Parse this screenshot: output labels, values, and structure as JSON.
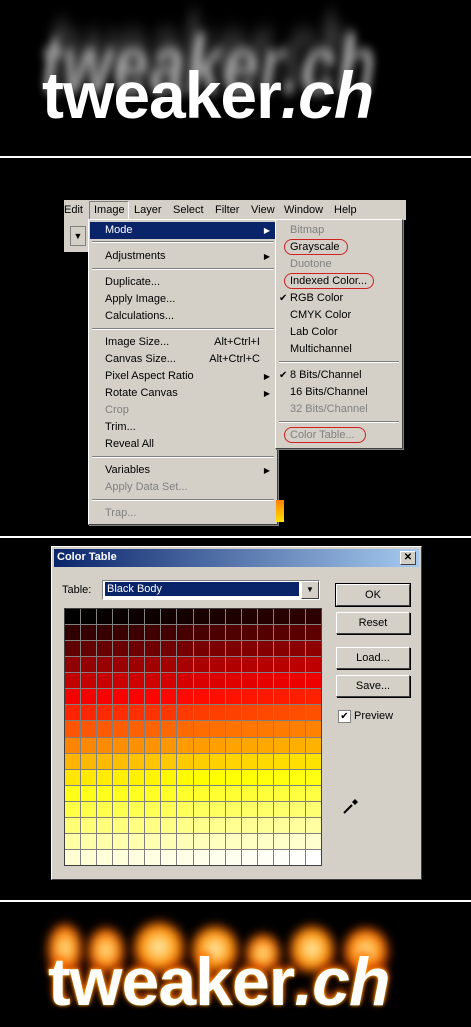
{
  "logo": {
    "text": "tweaker",
    "suffix": ".ch"
  },
  "menubar": {
    "items": [
      "Edit",
      "Image",
      "Layer",
      "Select",
      "Filter",
      "View",
      "Window",
      "Help"
    ]
  },
  "image_menu": {
    "mode": "Mode",
    "adjustments": "Adjustments",
    "duplicate": "Duplicate...",
    "apply_image": "Apply Image...",
    "calculations": "Calculations...",
    "image_size": "Image Size...",
    "image_size_sc": "Alt+Ctrl+I",
    "canvas_size": "Canvas Size...",
    "canvas_size_sc": "Alt+Ctrl+C",
    "pixel_aspect": "Pixel Aspect Ratio",
    "rotate_canvas": "Rotate Canvas",
    "crop": "Crop",
    "trim": "Trim...",
    "reveal_all": "Reveal All",
    "variables": "Variables",
    "apply_data_set": "Apply Data Set...",
    "trap": "Trap..."
  },
  "mode_menu": {
    "bitmap": "Bitmap",
    "grayscale": "Grayscale",
    "duotone": "Duotone",
    "indexed": "Indexed Color...",
    "rgb": "RGB Color",
    "cmyk": "CMYK Color",
    "lab": "Lab Color",
    "multichannel": "Multichannel",
    "bits8": "8 Bits/Channel",
    "bits16": "16 Bits/Channel",
    "bits32": "32 Bits/Channel",
    "color_table": "Color Table...",
    "check": "✔"
  },
  "dialog": {
    "title": "Color Table",
    "close": "✕",
    "table_label": "Table:",
    "table_value": "Black Body",
    "ok": "OK",
    "reset": "Reset",
    "load": "Load...",
    "save": "Save...",
    "preview": "Preview",
    "preview_checked": true
  },
  "colors": {
    "highlight": "#0a246a",
    "dialog_bg": "#d4d0c8",
    "ring": "#d02020"
  }
}
